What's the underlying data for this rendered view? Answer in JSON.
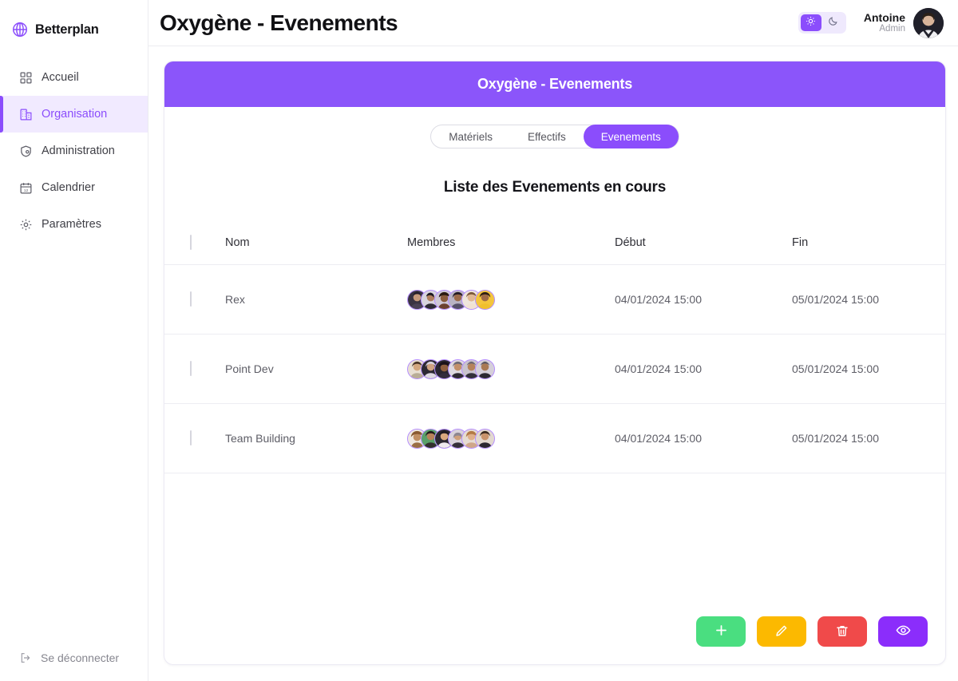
{
  "brand": {
    "name": "Betterplan",
    "logo_icon": "betterplan-globe-icon",
    "accent": "#8b4dfc"
  },
  "sidebar": {
    "items": [
      {
        "label": "Accueil",
        "icon": "grid-icon",
        "active": false
      },
      {
        "label": "Organisation",
        "icon": "building-icon",
        "active": true
      },
      {
        "label": "Administration",
        "icon": "shield-user-icon",
        "active": false
      },
      {
        "label": "Calendrier",
        "icon": "calendar-icon",
        "active": false
      },
      {
        "label": "Paramètres",
        "icon": "gear-icon",
        "active": false
      }
    ],
    "logout": {
      "label": "Se déconnecter",
      "icon": "logout-icon"
    }
  },
  "header": {
    "title": "Oxygène - Evenements",
    "theme": {
      "light_icon": "sun-icon",
      "dark_icon": "moon-icon",
      "selected": "light"
    },
    "user": {
      "name": "Antoine",
      "role": "Admin",
      "avatar": "user-avatar"
    }
  },
  "card": {
    "banner_title": "Oxygène - Evenements",
    "tabs": [
      {
        "label": "Matériels",
        "active": false
      },
      {
        "label": "Effectifs",
        "active": false
      },
      {
        "label": "Evenements",
        "active": true
      }
    ],
    "list_title": "Liste des Evenements en cours",
    "table": {
      "columns": [
        "Nom",
        "Membres",
        "Début",
        "Fin"
      ],
      "rows": [
        {
          "nom": "Rex",
          "members_count": 6,
          "debut": "04/01/2024 15:00",
          "fin": "05/01/2024 15:00"
        },
        {
          "nom": "Point Dev",
          "members_count": 6,
          "debut": "04/01/2024 15:00",
          "fin": "05/01/2024 15:00"
        },
        {
          "nom": "Team Building",
          "members_count": 6,
          "debut": "04/01/2024 15:00",
          "fin": "05/01/2024 15:00"
        }
      ]
    },
    "actions": [
      {
        "name": "add",
        "icon": "plus-icon",
        "color": "#4ade80"
      },
      {
        "name": "edit",
        "icon": "pencil-icon",
        "color": "#fcb900"
      },
      {
        "name": "delete",
        "icon": "trash-icon",
        "color": "#f04a4a"
      },
      {
        "name": "view",
        "icon": "eye-icon",
        "color": "#8b2dfb"
      }
    ]
  }
}
